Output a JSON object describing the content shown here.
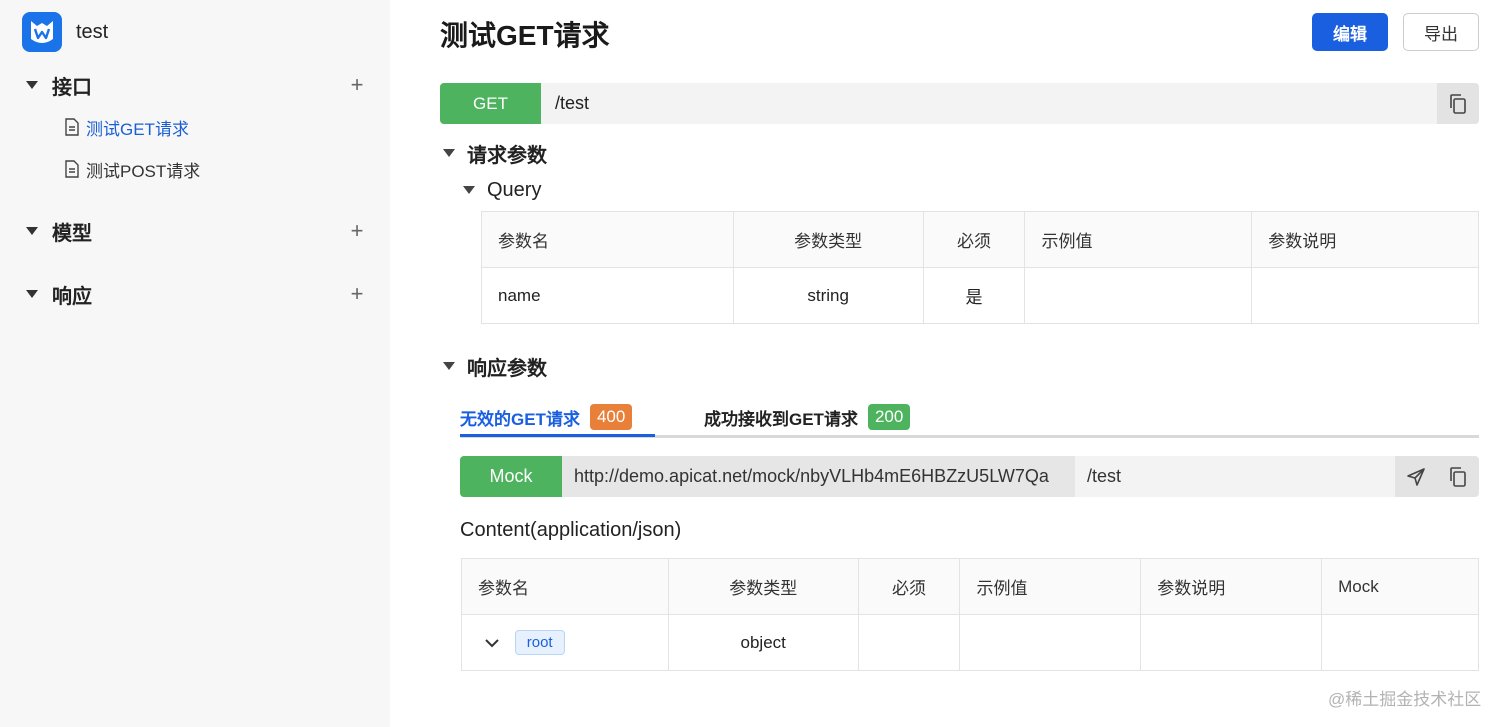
{
  "sidebar": {
    "project_name": "test",
    "groups": [
      {
        "title": "接口",
        "items": [
          {
            "label": "测试GET请求"
          },
          {
            "label": "测试POST请求"
          }
        ]
      },
      {
        "title": "模型"
      },
      {
        "title": "响应"
      }
    ],
    "plus": "+"
  },
  "header": {
    "title": "测试GET请求",
    "edit_label": "编辑",
    "export_label": "导出"
  },
  "request": {
    "method": "GET",
    "path": "/test"
  },
  "request_params": {
    "title": "请求参数",
    "query_title": "Query",
    "columns": [
      "参数名",
      "参数类型",
      "必须",
      "示例值",
      "参数说明"
    ],
    "rows": [
      [
        "name",
        "string",
        "是",
        "",
        ""
      ]
    ]
  },
  "response_params": {
    "title": "响应参数",
    "tabs": [
      {
        "label": "无效的GET请求",
        "badge": "400",
        "badge_color": "#e8803a"
      },
      {
        "label": "成功接收到GET请求",
        "badge": "200",
        "badge_color": "#4db35e"
      }
    ],
    "mock_label": "Mock",
    "mock_url": "http://demo.apicat.net/mock/nbyVLHb4mE6HBZzU5LW7Qa",
    "mock_path": "/test",
    "content_type": "Content(application/json)",
    "columns": [
      "参数名",
      "参数类型",
      "必须",
      "示例值",
      "参数说明",
      "Mock"
    ],
    "rows": [
      {
        "name": "root",
        "type": "object"
      }
    ]
  },
  "watermark": "@稀土掘金技术社区"
}
